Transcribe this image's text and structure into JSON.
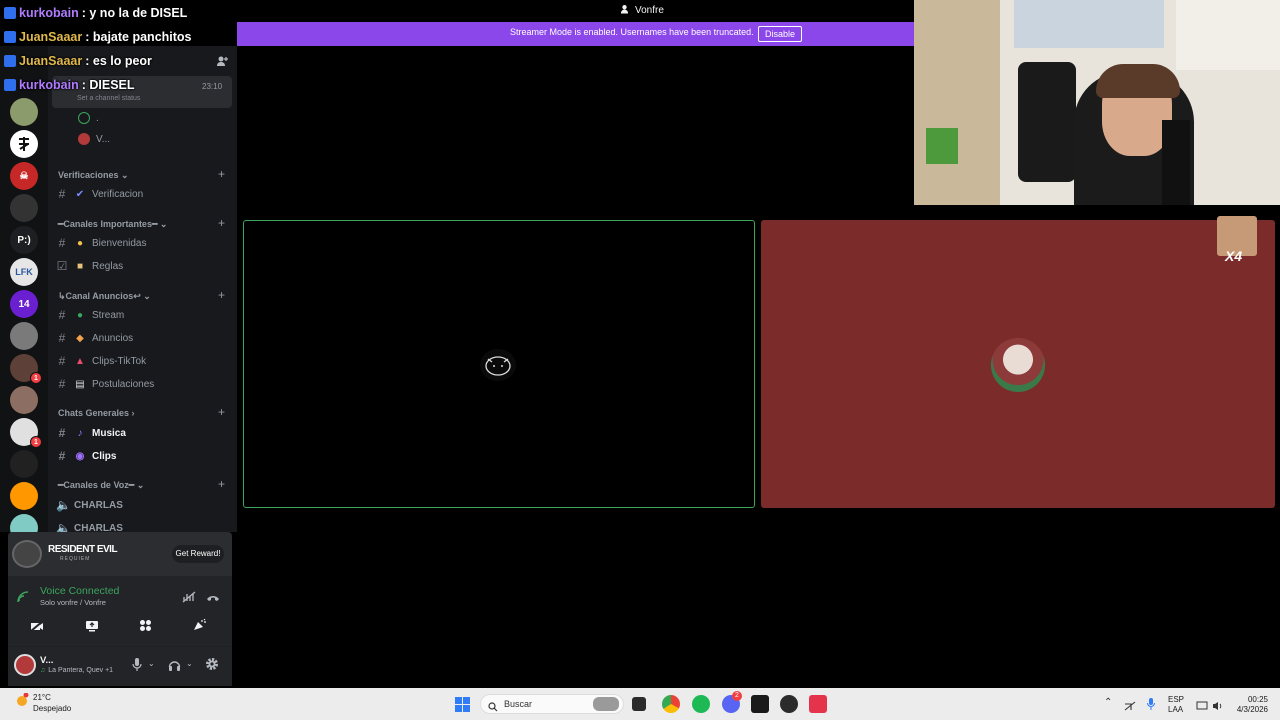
{
  "window": {
    "title": "Vonfre"
  },
  "streamer_banner": {
    "text": "Streamer Mode is enabled. Usernames have been truncated.",
    "button": "Disable"
  },
  "chat_overlay": [
    {
      "user": "kurkobain",
      "message": ": y no la de DISEL"
    },
    {
      "user": "JuanSaaar",
      "message": ": bajate panchitos"
    },
    {
      "user": "JuanSaaar",
      "message": ": es lo peor"
    },
    {
      "user": "kurkobain",
      "message": ": DIESEL"
    }
  ],
  "channel_status": {
    "time": "23:10",
    "placeholder": "Set a channel status"
  },
  "voice_members": [
    {
      "name": "."
    },
    {
      "name": "V..."
    }
  ],
  "servers": [
    {
      "label": "",
      "badge": ""
    },
    {
      "label": "",
      "badge": ""
    },
    {
      "label": "",
      "badge": ""
    },
    {
      "label": "",
      "badge": ""
    },
    {
      "label": "P:)",
      "badge": ""
    },
    {
      "label": "",
      "badge": ""
    },
    {
      "label": "",
      "badge": ""
    },
    {
      "label": "",
      "badge": ""
    },
    {
      "label": "",
      "badge": "1"
    },
    {
      "label": "",
      "badge": ""
    },
    {
      "label": "",
      "badge": "1"
    },
    {
      "label": "",
      "badge": ""
    },
    {
      "label": "",
      "badge": ""
    },
    {
      "label": "",
      "badge": ""
    }
  ],
  "categories": {
    "verificaciones": "Verificaciones",
    "importantes": "━Canales Importantes━",
    "anuncios": "↳Canal Anuncios↩",
    "generales": "Chats Generales",
    "voz": "━Canales de Voz━"
  },
  "channels": {
    "verificacion": "Verificacion",
    "bienvenidas": "Bienvenidas",
    "reglas": "Reglas",
    "stream": "Stream",
    "anuncios": "Anuncios",
    "clips_tiktok": "Clips-TikTok",
    "postulaciones": "Postulaciones",
    "musica": "Musica",
    "clips": "Clips",
    "charlas1": "CHARLAS",
    "charlas2": "CHARLAS"
  },
  "promo": {
    "title": "RESIDENT EVIL",
    "subtitle": "REQUIEM",
    "button": "Get Reward!"
  },
  "voice": {
    "status": "Voice Connected",
    "location": "Solo vonfre / Vonfre"
  },
  "user": {
    "name": "V...",
    "activity": "La Pantera, Quev +1"
  },
  "tiles": {
    "right_badge": "X4"
  },
  "taskbar": {
    "weather_temp": "21°C",
    "weather_desc": "Despejado",
    "search_placeholder": "Buscar",
    "discord_badge": "2",
    "lang_top": "ESP",
    "lang_bottom": "LAA",
    "time": "00:25",
    "date": "4/3/2026"
  },
  "colors": {
    "banner": "#8c47eb",
    "voice_green": "#3ba55d",
    "tile_right": "#7c2b2b"
  }
}
